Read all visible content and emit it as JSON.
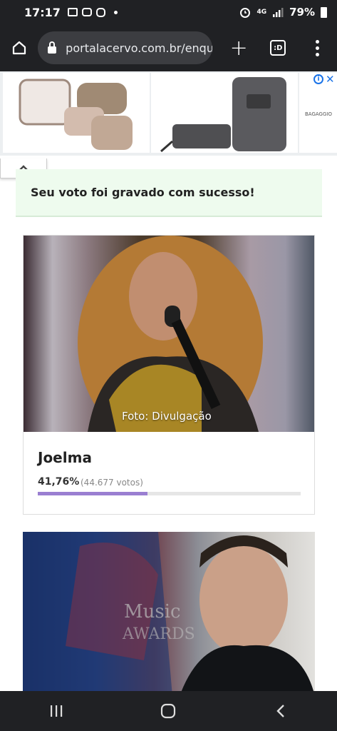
{
  "status_bar": {
    "time": "17:17",
    "network": "4G",
    "battery": "79%"
  },
  "browser": {
    "url": "portalacervo.com.br/enque",
    "tab_count": ":D"
  },
  "ad": {
    "brand": "BAGAGGIO"
  },
  "poll": {
    "success_message": "Seu voto foi gravado com sucesso!",
    "candidates": [
      {
        "name": "Joelma",
        "photo_credit": "Foto: Divulgação",
        "percent": "41,76%",
        "percent_value": 41.76,
        "votes": "(44.677 votos)",
        "bar_color": "#9a7fd1"
      }
    ]
  },
  "colors": {
    "chrome_dark": "#202124",
    "success_bg": "#eefbee",
    "accent": "#9a7fd1"
  }
}
